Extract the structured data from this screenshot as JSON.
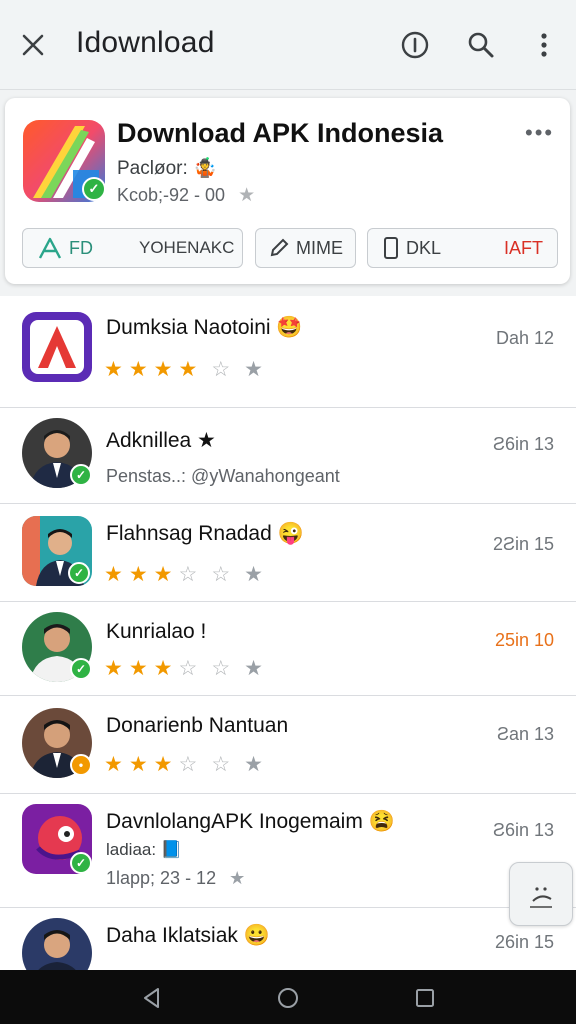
{
  "appbar": {
    "title": "Idownload",
    "icons": [
      "close-icon",
      "info-icon",
      "search-icon",
      "more-vert-icon"
    ]
  },
  "header_card": {
    "title": "Download APK Indonesia",
    "subtitle_1": "Pacløor: 🤹",
    "subtitle_2": "Kcob;-92  -  00",
    "more_label": "•••",
    "chips": [
      {
        "label_left": "FD",
        "label_right": "YOHENAKC",
        "icon": "apk-logo-icon"
      },
      {
        "label": "MIME",
        "icon": "pencil-icon"
      },
      {
        "label_left": "DKL",
        "label_right": "IAFT",
        "icon": "phone-icon"
      }
    ]
  },
  "list": [
    {
      "name": "Dumksia Naotoini 🤩",
      "date": "Dah 12",
      "rating": 4,
      "meta": ""
    },
    {
      "name": "Adknillea ★",
      "date": "Ƨ6in 13",
      "rating": null,
      "meta": "Penstas..: @yWanahongeant"
    },
    {
      "name": "Flahnsag Rnadad 😜",
      "date": "2Ƨin 15",
      "rating": 3,
      "meta": ""
    },
    {
      "name": "Kunrialao !",
      "date": "25in 10",
      "rating": 3,
      "meta": "",
      "date_color": "#e8711a"
    },
    {
      "name": "Donarienb Nantuan",
      "date": "Ƨan 13",
      "rating": 3,
      "meta": ""
    },
    {
      "name": "DavnlolangAPK Inogemaim 😫",
      "date": "Ƨ6in 13",
      "rating": null,
      "meta": "ladiaa: 📘",
      "meta2": "1lapp; 23  -  12"
    },
    {
      "name": "Daha Iklatsiak 😀",
      "date": "26in 15",
      "rating": null,
      "meta": ""
    }
  ],
  "colors": {
    "accent_green": "#2fb344",
    "star": "#f29900",
    "red_label": "#d93025"
  }
}
